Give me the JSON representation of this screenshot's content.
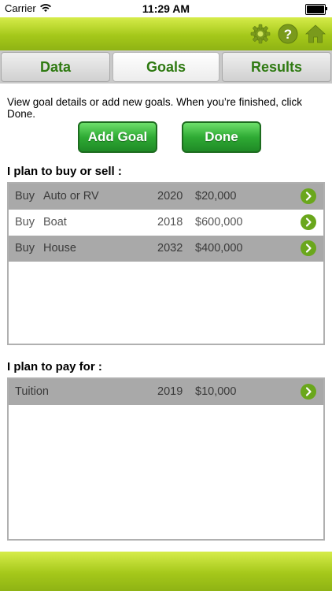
{
  "status": {
    "carrier": "Carrier",
    "time": "11:29 AM"
  },
  "header": {
    "icons": [
      "gear-icon",
      "help-icon",
      "home-icon"
    ],
    "help_glyph": "?"
  },
  "tabs": [
    {
      "label": "Data",
      "active": false
    },
    {
      "label": "Goals",
      "active": true
    },
    {
      "label": "Results",
      "active": false
    }
  ],
  "instructions": "View goal details or add new goals. When you’re finished, click Done.",
  "buttons": {
    "add_goal": "Add Goal",
    "done": "Done"
  },
  "buy_sell": {
    "title": "I plan to buy or sell :",
    "rows": [
      {
        "action": "Buy",
        "item": "Auto or RV",
        "year": "2020",
        "amount": "$20,000"
      },
      {
        "action": "Buy",
        "item": "Boat",
        "year": "2018",
        "amount": "$600,000"
      },
      {
        "action": "Buy",
        "item": "House",
        "year": "2032",
        "amount": "$400,000"
      }
    ]
  },
  "pay_for": {
    "title": "I plan to pay for :",
    "rows": [
      {
        "item": "Tuition",
        "year": "2019",
        "amount": "$10,000"
      }
    ]
  },
  "colors": {
    "header_green": "#a5c81a",
    "tab_text": "#2f7a12",
    "button_green": "#2fab34",
    "row_gray": "#a9a9a9",
    "chevron_green": "#6aa71c"
  }
}
